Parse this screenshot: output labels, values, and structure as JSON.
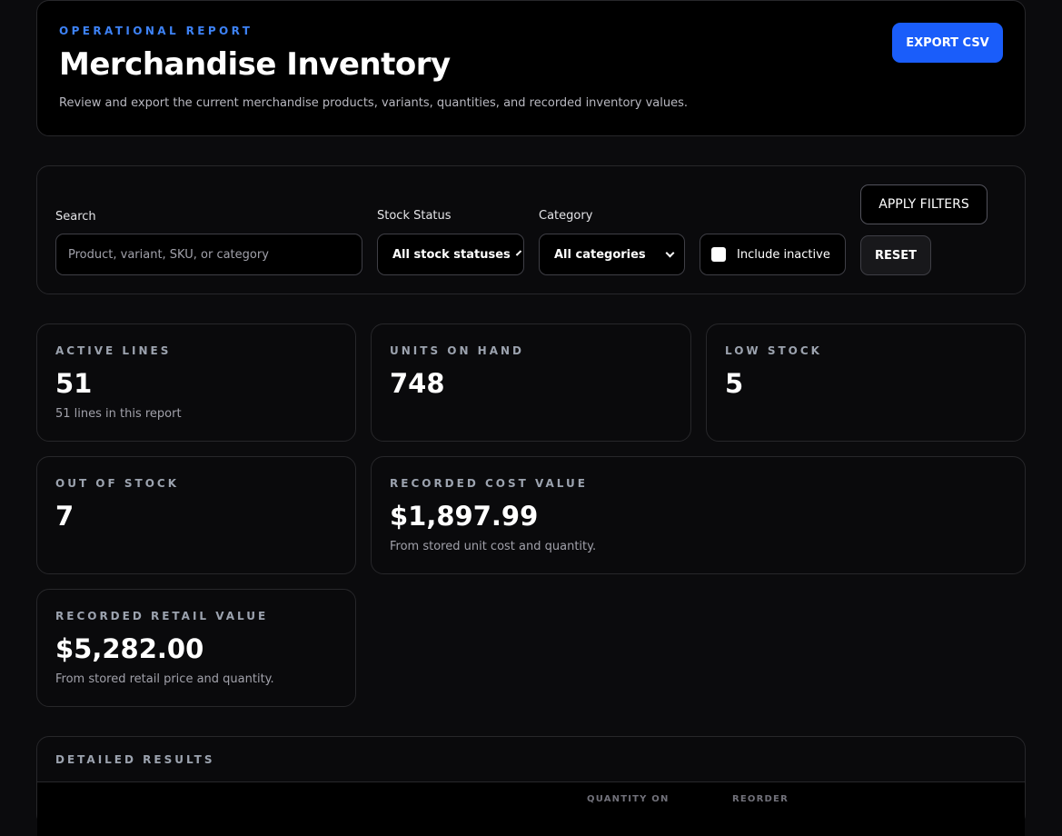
{
  "header": {
    "eyebrow": "OPERATIONAL REPORT",
    "title": "Merchandise Inventory",
    "description": "Review and export the current merchandise products, variants, quantities, and recorded inventory values.",
    "export_label": "EXPORT CSV"
  },
  "filters": {
    "search_label": "Search",
    "search_placeholder": "Product, variant, SKU, or category",
    "search_value": "",
    "stock_status_label": "Stock Status",
    "stock_status_selected": "All stock statuses",
    "category_label": "Category",
    "category_selected": "All categories",
    "include_inactive_label": "Include inactive",
    "include_inactive_checked": false,
    "apply_label": "APPLY FILTERS",
    "reset_label": "RESET"
  },
  "stats": {
    "active_lines": {
      "label": "ACTIVE LINES",
      "value": "51",
      "note": "51 lines in this report"
    },
    "units_on_hand": {
      "label": "UNITS ON HAND",
      "value": "748"
    },
    "low_stock": {
      "label": "LOW STOCK",
      "value": "5"
    },
    "out_of_stock": {
      "label": "OUT OF STOCK",
      "value": "7"
    },
    "recorded_cost_value": {
      "label": "RECORDED COST VALUE",
      "value": "$1,897.99",
      "note": "From stored unit cost and quantity."
    },
    "recorded_retail_value": {
      "label": "RECORDED RETAIL VALUE",
      "value": "$5,282.00",
      "note": "From stored retail price and quantity."
    }
  },
  "results": {
    "title": "DETAILED RESULTS",
    "columns": [
      "QUANTITY ON",
      "REORDER"
    ]
  },
  "colors": {
    "accent": "#1a5dfa",
    "eyebrow": "#3d82f6",
    "background": "#0b0b0d"
  }
}
